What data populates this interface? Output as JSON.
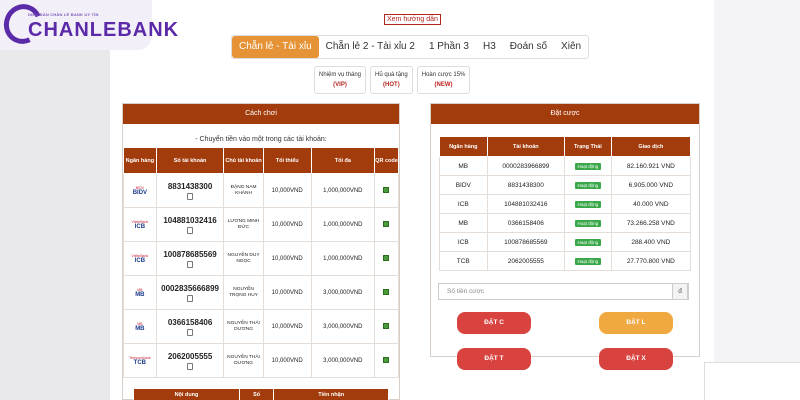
{
  "logo": {
    "small_text": "DIỄN ĐÀN CHẴN LẺ BANK UY TÍN",
    "main_text": "CHANLEBANK"
  },
  "guide_link": "Xem hướng dẫn",
  "tabs": [
    {
      "label": "Chẵn lẻ - Tài xỉu",
      "active": true
    },
    {
      "label": "Chẵn lẻ 2 - Tài xỉu 2"
    },
    {
      "label": "1 Phần 3"
    },
    {
      "label": "H3"
    },
    {
      "label": "Đoán số"
    },
    {
      "label": "Xiên"
    }
  ],
  "subtabs": [
    {
      "label": "Nhiệm vụ tháng",
      "tag": "(VIP)"
    },
    {
      "label": "Hũ quà tặng",
      "tag": "(HOT)"
    },
    {
      "label": "Hoàn cược 15%",
      "tag": "(NEW)"
    }
  ],
  "how_to_play": {
    "title": "Cách chơi",
    "note": "- Chuyển tiền vào một trong các tài khoản:",
    "headers": [
      "Ngân hàng",
      "Số tài khoản",
      "Chủ tài khoản",
      "Tối thiểu",
      "Tối đa",
      "QR code"
    ],
    "rows": [
      {
        "bank": "BIDV",
        "bank_small": "BIDV",
        "account": "8831438300",
        "owner": "ĐẶNG NAM KHÁNH",
        "min": "10,000VND",
        "max": "1,000,000VND"
      },
      {
        "bank": "ICB",
        "bank_small": "VietinBank",
        "account": "104881032416",
        "owner": "LƯƠNG MINH ĐỨC",
        "min": "10,000VND",
        "max": "1,000,000VND"
      },
      {
        "bank": "ICB",
        "bank_small": "VietinBank",
        "account": "100878685569",
        "owner": "NGUYỄN DUY NGỌC",
        "min": "10,000VND",
        "max": "1,000,000VND"
      },
      {
        "bank": "MB",
        "bank_small": "MB",
        "account": "0002835666899",
        "owner": "NGUYỄN TRỌNG HUY",
        "min": "10,000VND",
        "max": "3,000,000VND"
      },
      {
        "bank": "MB",
        "bank_small": "MB",
        "account": "0366158406",
        "owner": "NGUYỄN THÁI DƯƠNG",
        "min": "10,000VND",
        "max": "3,000,000VND"
      },
      {
        "bank": "TCB",
        "bank_small": "Techcombank",
        "account": "2062005555",
        "owner": "NGUYỄN THÁI DƯƠNG",
        "min": "10,000VND",
        "max": "3,000,000VND"
      }
    ],
    "bottom_headers": [
      "Nội dung",
      "Số",
      "Tiền nhận"
    ]
  },
  "place_bet": {
    "title": "Đặt cược",
    "headers": [
      "Ngân hàng",
      "Tài khoản",
      "Trạng Thái",
      "Giao dịch"
    ],
    "rows": [
      {
        "bank": "MB",
        "account": "0000283966899",
        "status": "Hoạt động",
        "amount": "82.160.921 VND"
      },
      {
        "bank": "BIDV",
        "account": "8831438300",
        "status": "Hoạt động",
        "amount": "6.905.000 VND"
      },
      {
        "bank": "ICB",
        "account": "104881032416",
        "status": "Hoạt động",
        "amount": "40.000 VND"
      },
      {
        "bank": "MB",
        "account": "0366158406",
        "status": "Hoạt động",
        "amount": "73.266.258 VND"
      },
      {
        "bank": "ICB",
        "account": "100878685569",
        "status": "Hoạt động",
        "amount": "288.400 VND"
      },
      {
        "bank": "TCB",
        "account": "2062005555",
        "status": "Hoạt động",
        "amount": "27.770.800 VND"
      }
    ],
    "amount_placeholder": "Số tiền cược",
    "unit": "đ",
    "buttons": [
      "ĐẶT C",
      "ĐẶT L",
      "ĐẶT T",
      "ĐẶT X"
    ]
  },
  "colors": {
    "header_brown": "#a23c0c",
    "tab_orange": "#e59336",
    "btn_red": "#d9433f",
    "btn_orange": "#f0a941",
    "status_green": "#3aa84a"
  }
}
